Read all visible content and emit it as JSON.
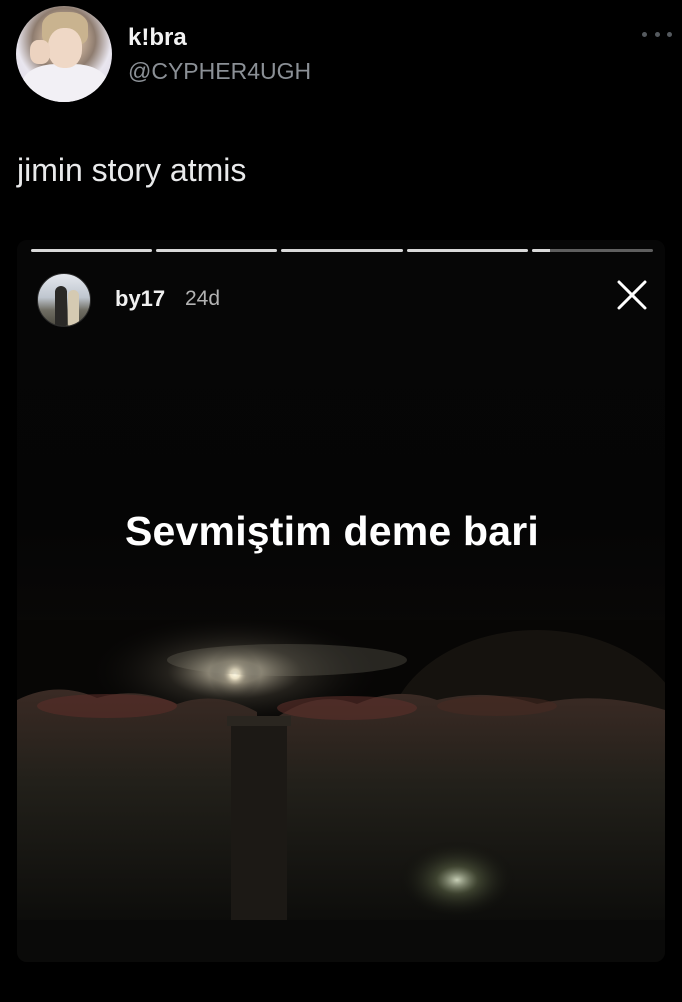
{
  "tweet": {
    "display_name": "k!bra",
    "handle": "@CYPHER4UGH",
    "text": "jimin story atmis"
  },
  "story": {
    "username": "by17",
    "time": "24d",
    "caption": "Sevmiştim deme bari",
    "progress": [
      1,
      1,
      1,
      1,
      0.15
    ]
  },
  "icons": {
    "more": "more-horizontal-icon",
    "close": "close-icon"
  },
  "colors": {
    "background": "#000000",
    "handle": "#8b9096",
    "progress_done": "#d9d9d9",
    "progress_track": "#5e5e5e"
  }
}
